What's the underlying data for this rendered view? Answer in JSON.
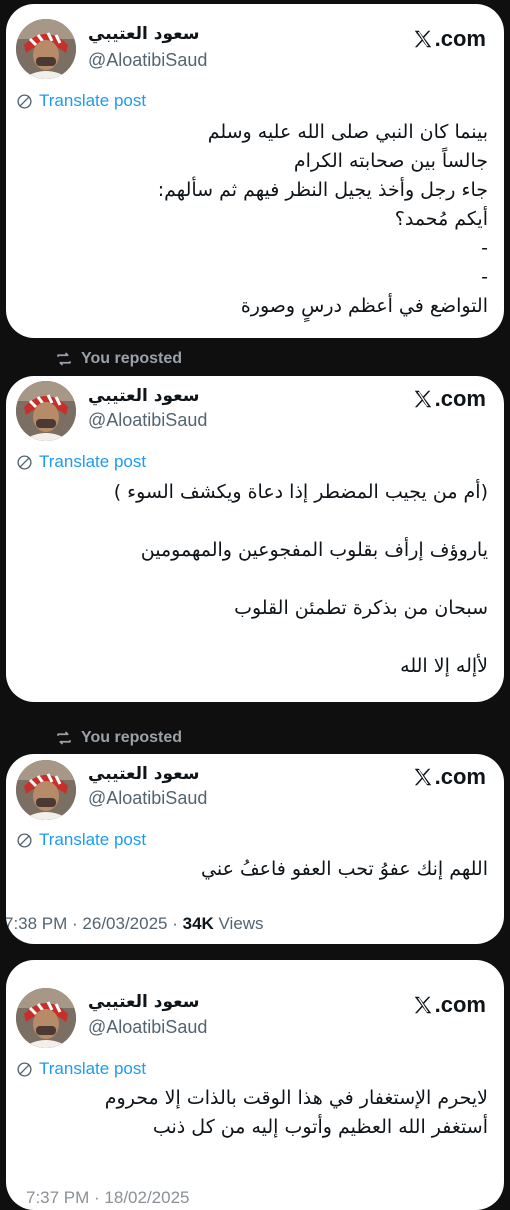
{
  "brand": {
    "xcom_label": ".com"
  },
  "author": {
    "display_name": "سعود العتيبي",
    "handle": "@AloatibiSaud"
  },
  "translate_label": "Translate post",
  "repost_label": "You reposted",
  "posts": [
    {
      "lines": [
        "بينما كان النبي صلى الله عليه وسلم",
        "جالساً بين صحابته الكرام",
        "جاء رجل وأخذ يجيل النظر فيهم ثم سألهم:",
        "أيكم مُحمد؟",
        "-",
        "-",
        "التواضع في أعظم درسٍ وصورة"
      ]
    },
    {
      "lines": [
        "(أم من يجيب المضطر إذا دعاة ويكشف السوء )",
        "",
        "ياروؤف إرأف بقلوب المفجوعين والمهمومين",
        "",
        "سبحان من بذكرة  تطمئن القلوب",
        "",
        "لأإله إلا الله"
      ]
    },
    {
      "lines": [
        "اللهم إنك عفوُ تحب العفو فاعفُ عني"
      ],
      "meta": {
        "time_date": "7:38 PM · 26/03/2025 · ",
        "views_count": "34K",
        "views_label": " Views"
      }
    },
    {
      "lines": [
        "لايحرم الإستغفار في هذا  الوقت بالذات  إلا محروم",
        "أستغفر الله العظيم  وأتوب إليه من كل ذنب"
      ],
      "meta_partial": "7:37 PM · 18/02/2025"
    }
  ]
}
